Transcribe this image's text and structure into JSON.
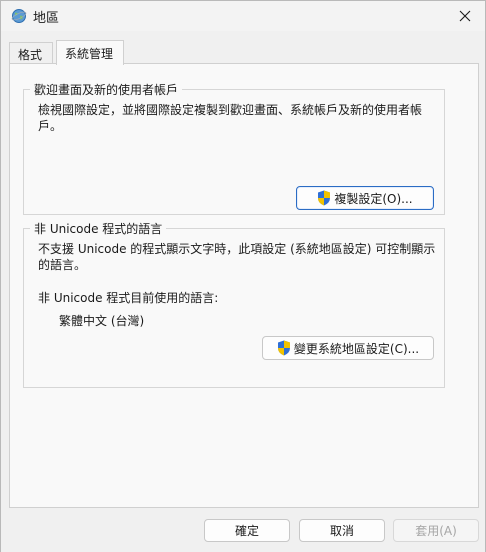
{
  "window": {
    "title": "地區",
    "icon": "globe-icon",
    "close_icon": "close-icon"
  },
  "tabs": [
    {
      "label": "格式",
      "active": false
    },
    {
      "label": "系統管理",
      "active": true
    }
  ],
  "welcome_group": {
    "legend": "歡迎畫面及新的使用者帳戶",
    "description": "檢視國際設定，並將國際設定複製到歡迎畫面、系統帳戶及新的使用者帳戶。",
    "button_label": "複製設定(O)...",
    "button_icon": "uac-shield-icon"
  },
  "unicode_group": {
    "legend": "非 Unicode 程式的語言",
    "description": "不支援 Unicode 的程式顯示文字時，此項設定 (系統地區設定) 可控制顯示的語言。",
    "current_label": "非 Unicode 程式目前使用的語言:",
    "current_value": "繁體中文 (台灣)",
    "button_label": "變更系統地區設定(C)...",
    "button_icon": "uac-shield-icon"
  },
  "footer": {
    "ok_label": "確定",
    "cancel_label": "取消",
    "apply_label": "套用(A)",
    "apply_disabled": true
  },
  "colors": {
    "focus_border": "#2b6cc4",
    "shield_blue": "#2f6fd6",
    "shield_yellow": "#f2c200"
  }
}
